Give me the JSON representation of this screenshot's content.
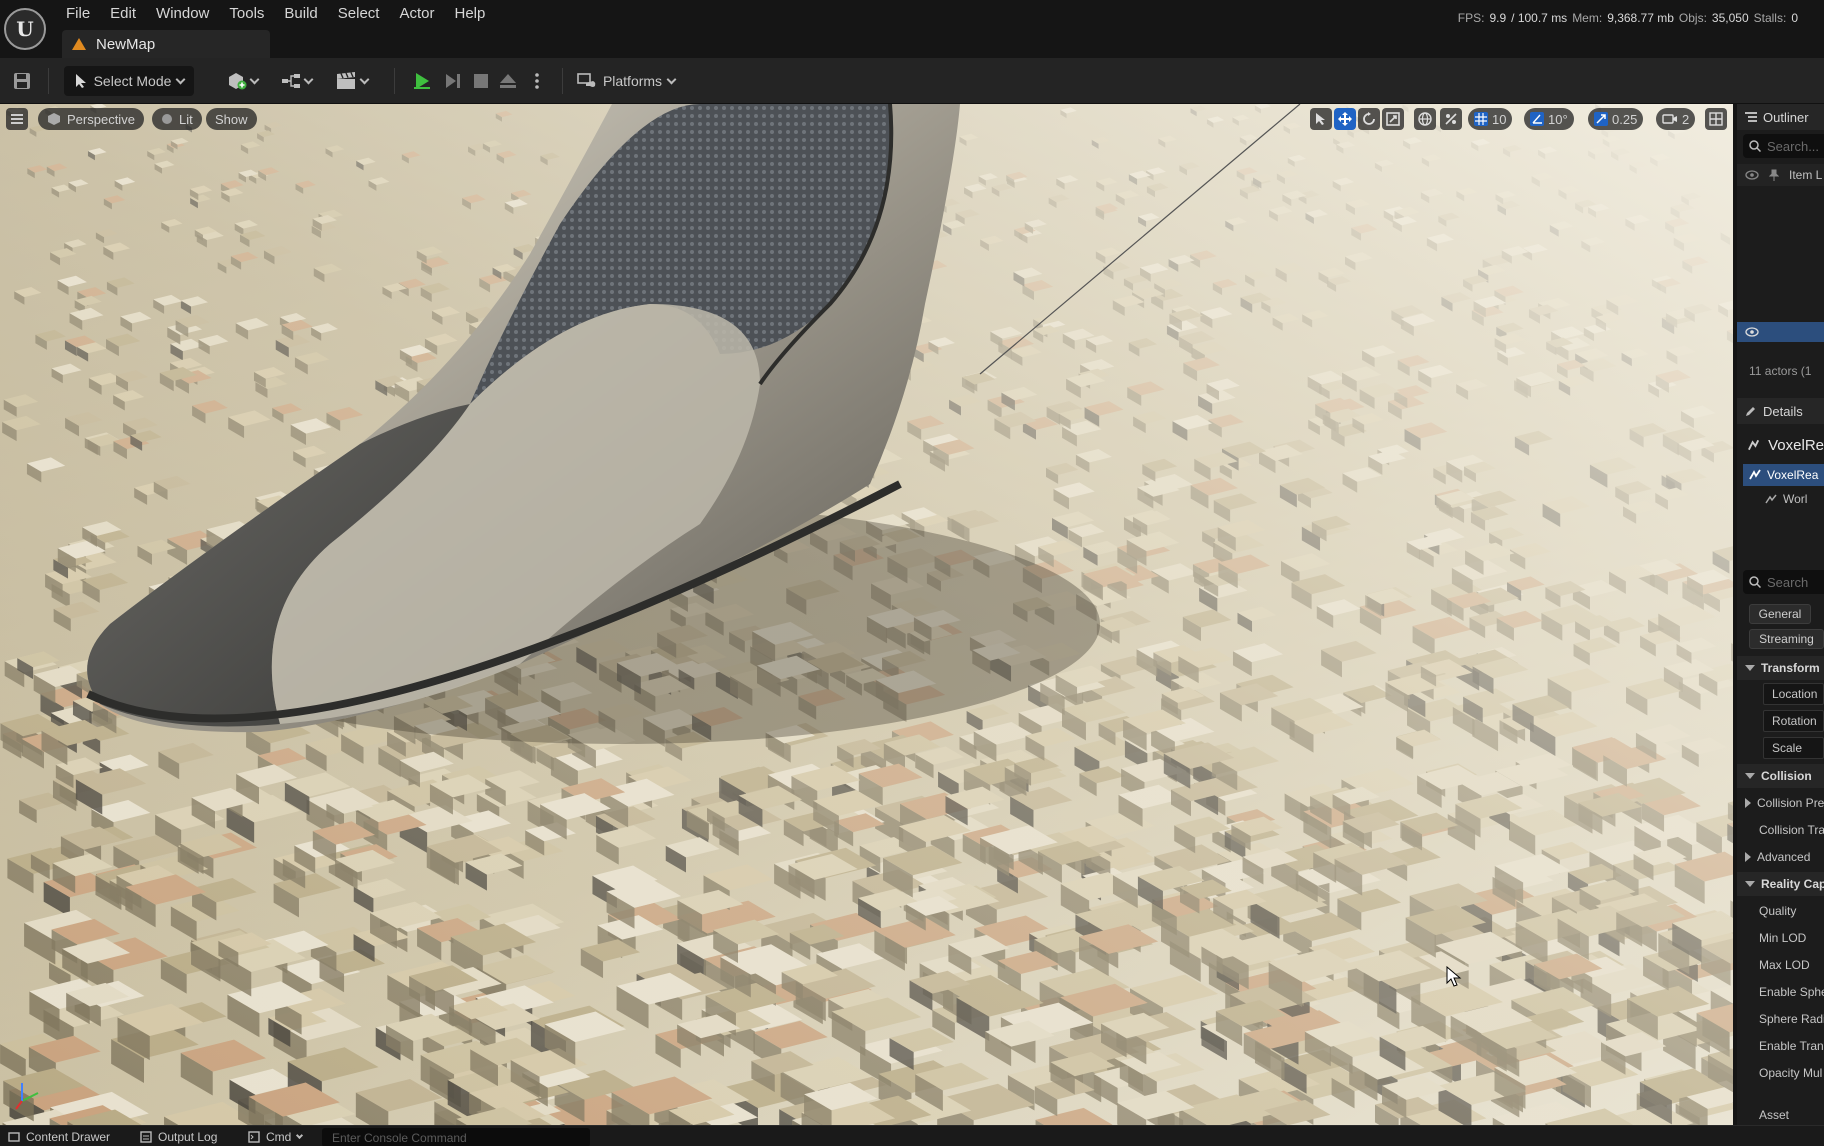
{
  "app": {
    "logo_text": "U",
    "menu": [
      "File",
      "Edit",
      "Window",
      "Tools",
      "Build",
      "Select",
      "Actor",
      "Help"
    ],
    "map_tab": "NewMap"
  },
  "stats": {
    "fps_label": "FPS:",
    "fps": "9.9",
    "ms": "/ 100.7 ms",
    "mem_label": "Mem:",
    "mem": "9,368.77 mb",
    "objs_label": "Objs:",
    "objs": "35,050",
    "stalls_label": "Stalls:",
    "stalls": "0"
  },
  "toolbar": {
    "select_mode": "Select Mode",
    "platforms": "Platforms"
  },
  "viewport": {
    "perspective": "Perspective",
    "lit": "Lit",
    "show": "Show",
    "grid_snap": "10",
    "rotation_snap": "10°",
    "scale_snap": "0.25",
    "camera_speed": "2"
  },
  "outliner": {
    "title": "Outliner",
    "search_placeholder": "Search...",
    "column_item": "Item L",
    "actor_count": "11 actors (1"
  },
  "details": {
    "title": "Details",
    "object_name": "VoxelRe",
    "component_root": "VoxelRea",
    "component_child": "Worl",
    "search_placeholder": "Search",
    "tabs": [
      "General",
      "Streaming"
    ],
    "sections": {
      "transform": "Transform",
      "transform_props": [
        "Location",
        "Rotation",
        "Scale"
      ],
      "collision": "Collision",
      "collision_props": [
        "Collision Pre",
        "Collision Tra",
        "Advanced"
      ],
      "reality": "Reality Capt",
      "reality_props": [
        "Quality",
        "Min LOD",
        "Max LOD",
        "Enable Sphe",
        "Sphere Radi",
        "Enable Trans",
        "Opacity Mul"
      ],
      "asset": "Asset"
    }
  },
  "bottom": {
    "content_drawer": "Content Drawer",
    "output_log": "Output Log",
    "cmd": "Cmd",
    "console_placeholder": "Enter Console Command"
  }
}
